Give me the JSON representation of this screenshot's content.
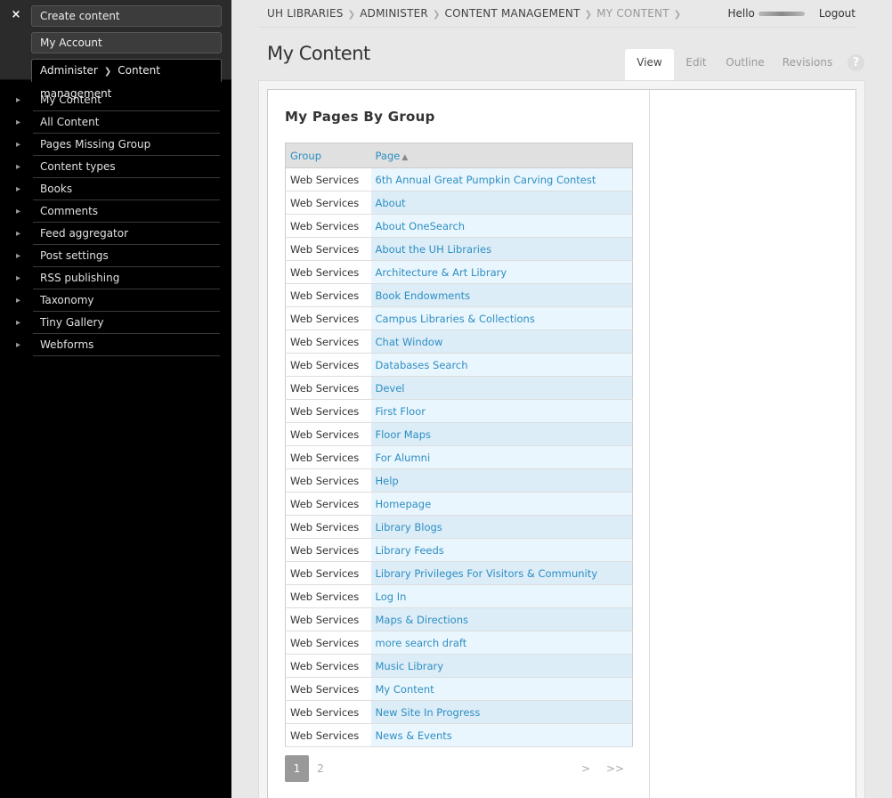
{
  "sidebar": {
    "close_symbol": "×",
    "create_content": "Create content",
    "my_account": "My Account",
    "admin_crumb": {
      "part1": "Administer",
      "part2": "Content management"
    },
    "menu": [
      "My Content",
      "All Content",
      "Pages Missing Group",
      "Content types",
      "Books",
      "Comments",
      "Feed aggregator",
      "Post settings",
      "RSS publishing",
      "Taxonomy",
      "Tiny Gallery",
      "Webforms"
    ]
  },
  "breadcrumb": [
    "UH LIBRARIES",
    "ADMINISTER",
    "CONTENT MANAGEMENT",
    "MY CONTENT"
  ],
  "user": {
    "greeting": "Hello",
    "logout": "Logout"
  },
  "page_title": "My Content",
  "tabs": [
    "View",
    "Edit",
    "Outline",
    "Revisions"
  ],
  "help_symbol": "?",
  "block_title": "My Pages By Group",
  "table": {
    "headers": {
      "group": "Group",
      "page": "Page"
    },
    "rows": [
      {
        "group": "Web Services",
        "page": "6th Annual Great Pumpkin Carving Contest"
      },
      {
        "group": "Web Services",
        "page": "About"
      },
      {
        "group": "Web Services",
        "page": "About OneSearch"
      },
      {
        "group": "Web Services",
        "page": "About the UH Libraries"
      },
      {
        "group": "Web Services",
        "page": "Architecture & Art Library"
      },
      {
        "group": "Web Services",
        "page": "Book Endowments"
      },
      {
        "group": "Web Services",
        "page": "Campus Libraries & Collections"
      },
      {
        "group": "Web Services",
        "page": "Chat Window"
      },
      {
        "group": "Web Services",
        "page": "Databases Search"
      },
      {
        "group": "Web Services",
        "page": "Devel"
      },
      {
        "group": "Web Services",
        "page": "First Floor"
      },
      {
        "group": "Web Services",
        "page": "Floor Maps"
      },
      {
        "group": "Web Services",
        "page": "For Alumni"
      },
      {
        "group": "Web Services",
        "page": "Help"
      },
      {
        "group": "Web Services",
        "page": "Homepage"
      },
      {
        "group": "Web Services",
        "page": "Library Blogs"
      },
      {
        "group": "Web Services",
        "page": "Library Feeds"
      },
      {
        "group": "Web Services",
        "page": "Library Privileges For Visitors & Community"
      },
      {
        "group": "Web Services",
        "page": "Log In"
      },
      {
        "group": "Web Services",
        "page": "Maps & Directions"
      },
      {
        "group": "Web Services",
        "page": "more search draft"
      },
      {
        "group": "Web Services",
        "page": "Music Library"
      },
      {
        "group": "Web Services",
        "page": "My Content"
      },
      {
        "group": "Web Services",
        "page": "New Site In Progress"
      },
      {
        "group": "Web Services",
        "page": "News & Events"
      }
    ]
  },
  "pager": {
    "current": "1",
    "page2": "2",
    "next": ">",
    "last": ">>"
  }
}
